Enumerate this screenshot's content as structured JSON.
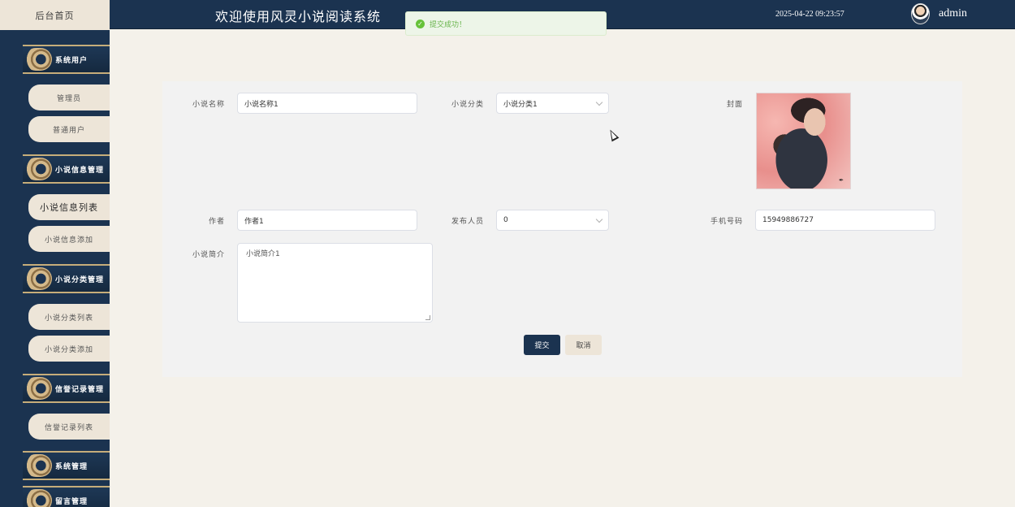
{
  "header": {
    "home_tab": "后台首页",
    "title": "欢迎使用风灵小说阅读系统",
    "datetime": "2025-04-22 09:23:57",
    "username": "admin"
  },
  "toast": {
    "message": "提交成功！"
  },
  "sidebar": {
    "groups": [
      {
        "label": "系统用户",
        "icon": "ornament-icon"
      },
      {
        "label": "小说信息管理",
        "icon": "ornament-icon"
      },
      {
        "label": "小说分类管理",
        "icon": "ornament-icon"
      },
      {
        "label": "信誉记录管理",
        "icon": "ornament-icon"
      },
      {
        "label": "系统管理",
        "icon": "ornament-icon"
      },
      {
        "label": "留言管理",
        "icon": "ornament-icon"
      }
    ],
    "items": [
      {
        "label": "管理员"
      },
      {
        "label": "普通用户"
      },
      {
        "label": "小说信息列表"
      },
      {
        "label": "小说信息添加"
      },
      {
        "label": "小说分类列表"
      },
      {
        "label": "小说分类添加"
      },
      {
        "label": "信誉记录列表"
      }
    ]
  },
  "form": {
    "name_label": "小说名称",
    "name_value": "小说名称1",
    "category_label": "小说分类",
    "category_value": "小说分类1",
    "cover_label": "封面",
    "author_label": "作者",
    "author_value": "作者1",
    "publisher_label": "发布人员",
    "publisher_value": "0",
    "phone_label": "手机号码",
    "phone_value": "15949886727",
    "intro_label": "小说简介",
    "intro_value": "小说简介1",
    "submit_label": "提交",
    "cancel_label": "取消"
  },
  "colors": {
    "primary": "#1b3350",
    "cream": "#ede5d8",
    "background": "#f4f1ea",
    "gold": "#c6ad7a",
    "success": "#67c23a"
  }
}
